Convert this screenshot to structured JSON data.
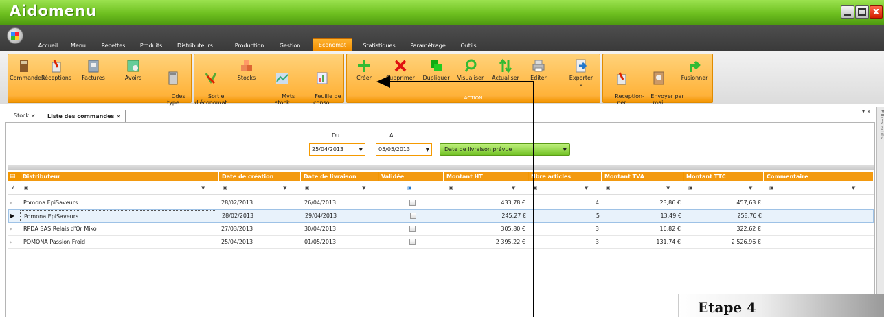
{
  "app": {
    "title": "Aidomenu"
  },
  "menu": {
    "tabs": [
      "Accueil",
      "Menu",
      "Recettes",
      "Produits",
      "Distributeurs",
      "Production",
      "Gestion",
      "Economat",
      "Statistiques",
      "Paramétrage",
      "Outils"
    ],
    "active": "Economat"
  },
  "ribbon": {
    "group1": [
      "Commandes",
      "Réceptions",
      "Factures",
      "Avoirs",
      "Cdes\ntype"
    ],
    "group2": [
      "Sortie\nd'économat",
      "Stocks",
      "Mvts\nstock",
      "Feuille de\nconso."
    ],
    "group3": [
      "Créer",
      "Supprimer",
      "Dupliquer",
      "Visualiser",
      "Actualiser",
      "Editer",
      "Exporter"
    ],
    "group3_label": "ACTION",
    "group4": [
      "Reception-\nner",
      "Envoyer par\nmail",
      "Fusionner"
    ]
  },
  "doctabs": [
    "Stock",
    "Liste des commandes"
  ],
  "filters": {
    "du_label": "Du",
    "au_label": "Au",
    "du_value": "25/04/2013",
    "au_value": "05/05/2013",
    "date_type": "Date de livraison prévue",
    "side_label": "Filtres actifs"
  },
  "grid": {
    "columns": [
      "Distributeur",
      "Date de création",
      "Date de livraison",
      "Validée",
      "Montant HT",
      "Nbre articles",
      "Montant TVA",
      "Montant TTC",
      "Commentaire"
    ],
    "rows": [
      {
        "distributeur": "Pomona EpiSaveurs",
        "creation": "28/02/2013",
        "livraison": "26/04/2013",
        "ht": "433,78 €",
        "nb": "4",
        "tva": "23,86 €",
        "ttc": "457,63 €"
      },
      {
        "distributeur": "Pomona EpiSaveurs",
        "creation": "28/02/2013",
        "livraison": "29/04/2013",
        "ht": "245,27 €",
        "nb": "5",
        "tva": "13,49 €",
        "ttc": "258,76 €"
      },
      {
        "distributeur": "RPDA SAS Relais d'Or Miko",
        "creation": "27/03/2013",
        "livraison": "30/04/2013",
        "ht": "305,80 €",
        "nb": "3",
        "tva": "16,82 €",
        "ttc": "322,62 €"
      },
      {
        "distributeur": "POMONA Passion Froid",
        "creation": "25/04/2013",
        "livraison": "01/05/2013",
        "ht": "2 395,22 €",
        "nb": "3",
        "tva": "131,74 €",
        "ttc": "2 526,96 €"
      }
    ]
  },
  "overlay": {
    "step": "Etape 4"
  },
  "colors": {
    "accent": "#f39a10",
    "title_green": "#6ec020"
  }
}
